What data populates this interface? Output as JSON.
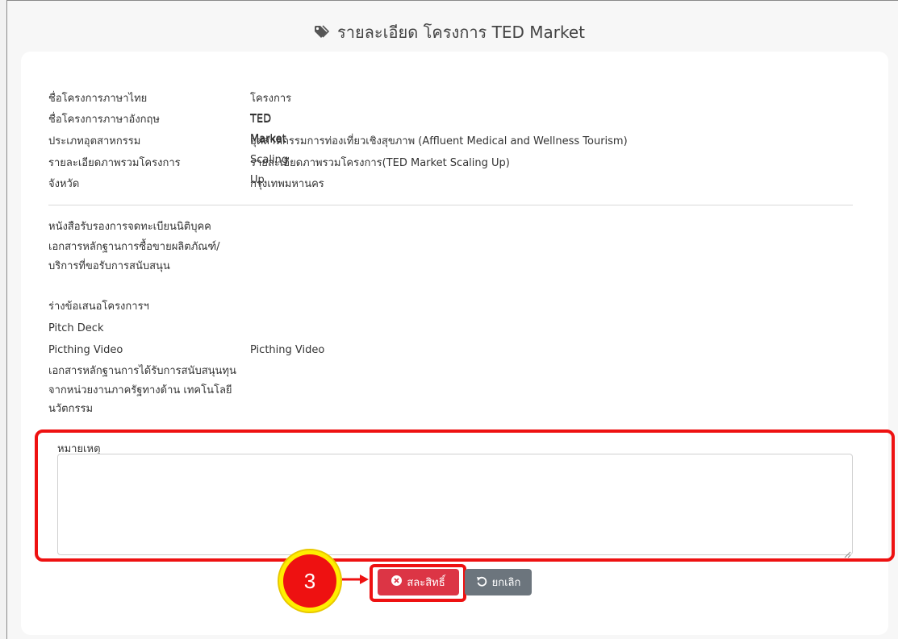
{
  "header": {
    "title": "รายละเอียด โครงการ TED Market",
    "icon": "tag-icon"
  },
  "project_info": [
    {
      "label": "ชื่อโครงการภาษาไทย",
      "value": "โครงการ TED Market"
    },
    {
      "label": "ชื่อโครงการภาษาอังกฤษ",
      "value": "TED Market Scaling Up"
    },
    {
      "label": "ประเภทอุตสาหกรรม",
      "value": "อุตสาหกรรมการท่องเที่ยวเชิงสุขภาพ (Affluent Medical and Wellness Tourism)"
    },
    {
      "label": "รายละเอียดภาพรวมโครงการ",
      "value": "รายละเอียดภาพรวมโครงการ(TED Market Scaling Up)"
    },
    {
      "label": "จังหวัด",
      "value": "กรุงเทพมหานคร"
    }
  ],
  "documents": [
    {
      "label": "หนังสือรับรองการจดทะเบียนนิติบุคค",
      "value": ""
    },
    {
      "label": "เอกสารหลักฐานการซื้อขายผลิตภัณฑ์/บริการที่ขอรับการสนับสนุน",
      "value": ""
    },
    {
      "label": "ร่างข้อเสนอโครงการฯ",
      "value": ""
    },
    {
      "label": "Pitch Deck",
      "value": ""
    },
    {
      "label": "Picthing Video",
      "value": "Picthing Video"
    },
    {
      "label": "เอกสารหลักฐานการได้รับการสนับสนุนทุนจากหน่วยงานภาครัฐทางด้าน เทคโนโลยีนวัตกรรม",
      "value": ""
    }
  ],
  "note": {
    "label": "หมายเหตุ",
    "value": "",
    "placeholder": ""
  },
  "annotation": {
    "step": "3",
    "highlight_color": "#ee1111",
    "circle_color": "#ffee00"
  },
  "buttons": {
    "waive_label": "สละสิทธิ์",
    "waive_icon": "circle-x-icon",
    "waive_color": "#dc3545",
    "cancel_label": "ยกเลิก",
    "cancel_icon": "undo-icon",
    "cancel_color": "#6c757d"
  }
}
